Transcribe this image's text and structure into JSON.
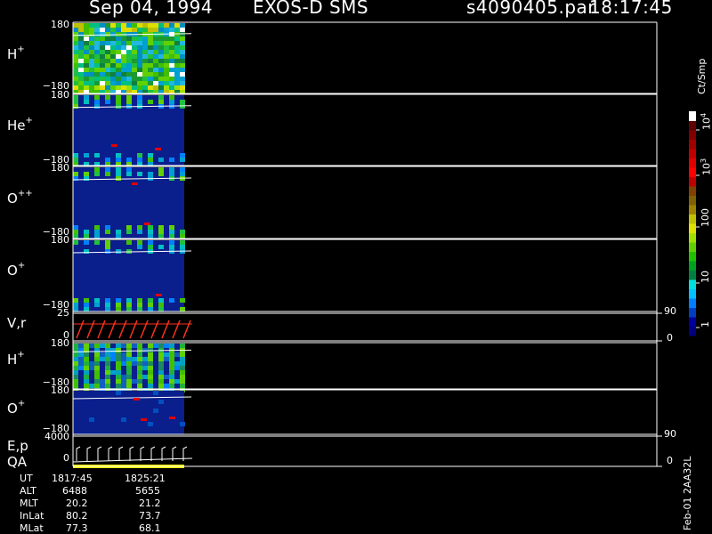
{
  "header": {
    "date": "Sep 04, 1994",
    "instrument": "EXOS-D SMS",
    "file": "s4090405.par",
    "time": "18:17:45"
  },
  "panels": [
    {
      "id": "h_plus",
      "label": "H",
      "sup": "+",
      "ytop": "180",
      "ybot": "−180"
    },
    {
      "id": "he_plus",
      "label": "He",
      "sup": "+",
      "ytop": "180",
      "ybot": "−180"
    },
    {
      "id": "o_pp",
      "label": "O",
      "sup": "++",
      "ytop": "180",
      "ybot": "−180"
    },
    {
      "id": "o_plus",
      "label": "O",
      "sup": "+",
      "ytop": "180",
      "ybot": "−180"
    },
    {
      "id": "vr",
      "label": "V,r",
      "sup": "",
      "ytop": "25",
      "ybot": "0",
      "rtop": "90",
      "rbot": "0"
    },
    {
      "id": "h_plus2",
      "label": "H",
      "sup": "+",
      "ytop": "180",
      "ybot": "−180"
    },
    {
      "id": "o_plus2",
      "label": "O",
      "sup": "+",
      "ytop": "180",
      "ybot": "−180"
    },
    {
      "id": "ep",
      "label": "E,p",
      "label2": "QA",
      "sup": "",
      "ytop": "4000",
      "ybot": "0",
      "rtop": "90",
      "rbot": "0"
    }
  ],
  "colorbar": {
    "title": "Ct/Smp",
    "ticks": [
      "1",
      "10",
      "100",
      "10",
      "10"
    ],
    "tick_sups": [
      "",
      "",
      "",
      "3",
      "4"
    ],
    "colors": [
      "#000080",
      "#0000a0",
      "#0040c0",
      "#0080ff",
      "#00c0ff",
      "#00e0e0",
      "#008040",
      "#00a020",
      "#20c000",
      "#60d000",
      "#a0e000",
      "#e0e000",
      "#c0c000",
      "#a08000",
      "#806000",
      "#804000",
      "#c00000",
      "#ff0000",
      "#e00000",
      "#c00000",
      "#a00000",
      "#800000",
      "#600000",
      "#ffffff"
    ]
  },
  "info": {
    "rows": [
      {
        "label": "UT",
        "v1": "1817:45",
        "v2": "1825:21"
      },
      {
        "label": "ALT",
        "v1": "6488",
        "v2": "5655"
      },
      {
        "label": "MLT",
        "v1": "20.2",
        "v2": "21.2"
      },
      {
        "label": "InLat",
        "v1": "80.2",
        "v2": "73.7"
      },
      {
        "label": "MLat",
        "v1": "77.3",
        "v2": "68.1"
      }
    ]
  },
  "footer_vertical": "Feb-01 2AA32L",
  "chart_data": {
    "type": "heatmap",
    "title": "Sep 04, 1994   EXOS-D SMS   s4090405.par  18:17:45",
    "x_range_ut": [
      "1817:45",
      "1825:21"
    ],
    "panels": [
      "H+",
      "He+",
      "O++",
      "O+",
      "V,r",
      "H+",
      "O+",
      "E,p QA"
    ],
    "colorbar_label": "Ct/Smp",
    "colorbar_ticks": [
      "1",
      "10",
      "100",
      "10^3",
      "10^4"
    ]
  }
}
